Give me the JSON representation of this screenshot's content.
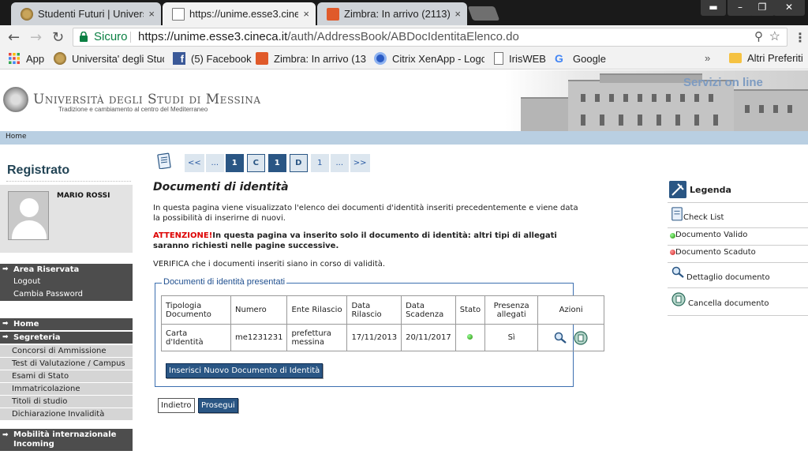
{
  "browser": {
    "tabs": [
      {
        "title": "Studenti Futuri | Universi",
        "close": "×",
        "active": false
      },
      {
        "title": "https://unime.esse3.cinec",
        "close": "×",
        "active": true
      },
      {
        "title": "Zimbra: In arrivo (2113)",
        "close": "×",
        "active": false
      }
    ],
    "security_label": "Sicuro",
    "url_host": "https://unime.esse3.cineca.it",
    "url_path": "/auth/AddressBook/ABDocIdentitaElenco.do",
    "bookmarks": [
      {
        "label": "App",
        "icon": "apps-grid-icon"
      },
      {
        "label": "Universita' degli Stud",
        "icon": "university-icon"
      },
      {
        "label": "(5) Facebook",
        "icon": "facebook-icon"
      },
      {
        "label": "Zimbra: In arrivo (134",
        "icon": "zimbra-icon"
      },
      {
        "label": "Citrix XenApp - Logo",
        "icon": "citrix-icon"
      },
      {
        "label": "IrisWEB",
        "icon": "page-icon"
      },
      {
        "label": "Google",
        "icon": "google-icon"
      }
    ],
    "bookmarks_overflow": "»",
    "other_bookmarks": "Altri Preferiti"
  },
  "header": {
    "university_name": "Università degli Studi di Messina",
    "tagline": "Tradizione e cambiamento al centro del Mediterraneo",
    "servizi": "Servizi on line"
  },
  "breadcrumb": {
    "home": "Home"
  },
  "sidebar": {
    "title": "Registrato",
    "user_name": "MARIO ROSSI",
    "area_riservata": {
      "title": "Area Riservata",
      "items": [
        "Logout",
        "Cambia Password"
      ]
    },
    "home": "Home",
    "segreteria": {
      "title": "Segreteria",
      "items": [
        "Concorsi di Ammissione",
        "Test di Valutazione / Campus",
        "Esami di Stato",
        "Immatricolazione",
        "Titoli di studio",
        "Dichiarazione Invalidità"
      ]
    },
    "mobilita": "Mobilità internazionale Incoming"
  },
  "pager": [
    "<<",
    "...",
    "1",
    "C",
    "1",
    "D",
    "1",
    "...",
    ">>"
  ],
  "main": {
    "title": "Documenti di identità",
    "intro": "In questa pagina viene visualizzato l'elenco dei documenti d'identità inseriti precedentemente e viene data la possibilità di inserirne di nuovi.",
    "warning_label": "ATTENZIONE!",
    "warning_text": "In questa pagina va inserito solo il documento di identità: altri tipi di allegati saranno richiesti nelle pagine successive.",
    "verify_text": "VERIFICA che i documenti inseriti siano in corso di validità.",
    "fieldset_legend": "Documenti di identità presentati",
    "table": {
      "headers": [
        "Tipologia Documento",
        "Numero",
        "Ente Rilascio",
        "Data Rilascio",
        "Data Scadenza",
        "Stato",
        "Presenza allegati",
        "Azioni"
      ],
      "rows": [
        {
          "tipologia": "Carta d'Identità",
          "numero": "me1231231",
          "ente": "prefettura messina",
          "data_rilascio": "17/11/2013",
          "data_scadenza": "20/11/2017",
          "stato": "valido",
          "allegati": "Sì"
        }
      ]
    },
    "btn_new": "Inserisci Nuovo Documento di Identità",
    "btn_back": "Indietro",
    "btn_next": "Prosegui"
  },
  "legend": {
    "title": "Legenda",
    "items": [
      "Check List",
      "Documento Valido",
      "Documento Scaduto",
      "Dettaglio documento",
      "Cancella documento"
    ]
  },
  "colors": {
    "primary": "#2a5684",
    "menu_dark": "#4d4d4d",
    "menu_light": "#d5d5d5",
    "warning": "#dd0000",
    "valid": "#28a028",
    "expired": "#d03030"
  }
}
